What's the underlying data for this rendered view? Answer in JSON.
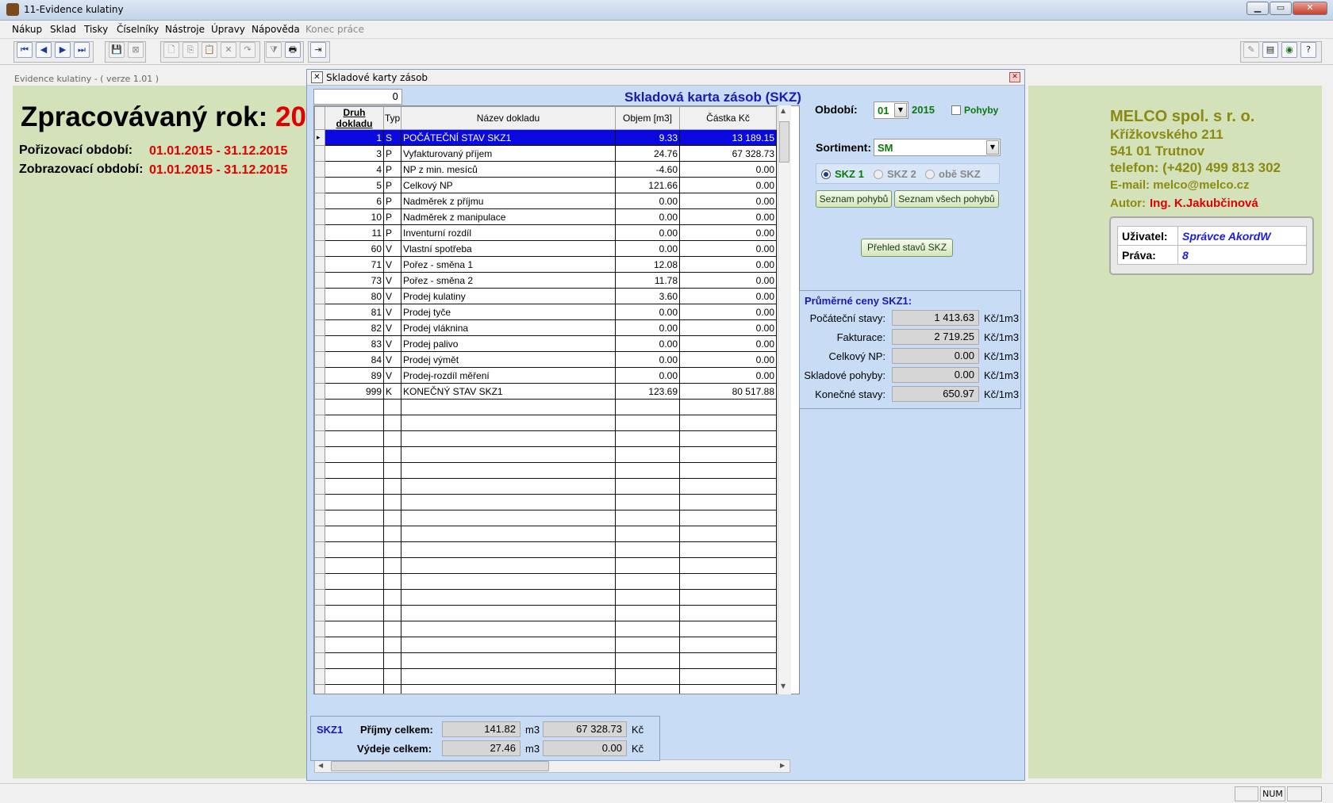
{
  "window": {
    "title": "11-Evidence kulatiny",
    "min_glyph": "▁",
    "max_glyph": "▭",
    "close_glyph": "✕"
  },
  "menu": {
    "items": [
      "Nákup",
      "Sklad",
      "Tisky",
      "Číselníky",
      "Nástroje",
      "Úpravy",
      "Nápověda"
    ],
    "disabled_item": "Konec práce"
  },
  "toolbar": {
    "nav_first": "⏮",
    "nav_prev": "◀",
    "nav_next": "▶",
    "nav_last": "⏭",
    "save": "💾",
    "cancel": "⊠",
    "new": "🗋",
    "copy": "⎘",
    "paste": "📋",
    "delete": "✕",
    "redo": "↷",
    "filter": "⧩",
    "print": "🖶",
    "exit": "⇥",
    "r1": "✎",
    "r2": "▤",
    "r3": "◉",
    "help": "?"
  },
  "left": {
    "version_line": "Evidence kulatiny   -   ( verze 1.01 )",
    "year_label": "Zpracovávaný rok:",
    "year_value": "20",
    "acq_label": "Pořizovací období:",
    "acq_value": "01.01.2015 - 31.12.2015",
    "disp_label": "Zobrazovací období:",
    "disp_value": "01.01.2015 - 31.12.2015"
  },
  "company": {
    "name": "MELCO spol. s r. o.",
    "street": "Křížkovského 211",
    "city": "541 01 Trutnov",
    "phone": "telefon: (+420) 499 813 302",
    "email": "E-mail: melco@melco.cz",
    "author_label": "Autor:",
    "author": "Ing. K.Jakubčinová"
  },
  "user": {
    "user_label": "Uživatel:",
    "user_value": "Správce AkordW",
    "rights_label": "Práva:",
    "rights_value": "8"
  },
  "dialog": {
    "title": "Skladové karty zásob",
    "heading": "Skladová karta zásob (SKZ)",
    "counter": "0",
    "close": "✕",
    "columns": [
      "Druh dokladu",
      "Typ",
      "Název dokladu",
      "Objem [m3]",
      "Částka Kč"
    ],
    "rows": [
      {
        "druh": "1",
        "typ": "S",
        "nazev": "POČÁTEČNÍ STAV SKZ1",
        "objem": "9.33",
        "castka": "13 189.15"
      },
      {
        "druh": "3",
        "typ": "P",
        "nazev": "Vyfakturovaný příjem",
        "objem": "24.76",
        "castka": "67 328.73"
      },
      {
        "druh": "4",
        "typ": "P",
        "nazev": "NP z min. mesíců",
        "objem": "-4.60",
        "castka": "0.00"
      },
      {
        "druh": "5",
        "typ": "P",
        "nazev": "Celkový NP",
        "objem": "121.66",
        "castka": "0.00"
      },
      {
        "druh": "6",
        "typ": "P",
        "nazev": "Nadměrek z příjmu",
        "objem": "0.00",
        "castka": "0.00"
      },
      {
        "druh": "10",
        "typ": "P",
        "nazev": "Nadměrek z manipulace",
        "objem": "0.00",
        "castka": "0.00"
      },
      {
        "druh": "11",
        "typ": "P",
        "nazev": "Inventurní rozdíl",
        "objem": "0.00",
        "castka": "0.00"
      },
      {
        "druh": "60",
        "typ": "V",
        "nazev": "Vlastní spotřeba",
        "objem": "0.00",
        "castka": "0.00"
      },
      {
        "druh": "71",
        "typ": "V",
        "nazev": "Pořez - směna 1",
        "objem": "12.08",
        "castka": "0.00"
      },
      {
        "druh": "73",
        "typ": "V",
        "nazev": "Pořez - směna 2",
        "objem": "11.78",
        "castka": "0.00"
      },
      {
        "druh": "80",
        "typ": "V",
        "nazev": "Prodej kulatiny",
        "objem": "3.60",
        "castka": "0.00"
      },
      {
        "druh": "81",
        "typ": "V",
        "nazev": "Prodej tyče",
        "objem": "0.00",
        "castka": "0.00"
      },
      {
        "druh": "82",
        "typ": "V",
        "nazev": "Prodej vláknina",
        "objem": "0.00",
        "castka": "0.00"
      },
      {
        "druh": "83",
        "typ": "V",
        "nazev": "Prodej palivo",
        "objem": "0.00",
        "castka": "0.00"
      },
      {
        "druh": "84",
        "typ": "V",
        "nazev": "Prodej výmět",
        "objem": "0.00",
        "castka": "0.00"
      },
      {
        "druh": "89",
        "typ": "V",
        "nazev": "Prodej-rozdíl měření",
        "objem": "0.00",
        "castka": "0.00"
      },
      {
        "druh": "999",
        "typ": "K",
        "nazev": "KONEČNÝ STAV SKZ1",
        "objem": "123.69",
        "castka": "80 517.88"
      }
    ],
    "empty_rows": 19,
    "period_label": "Období:",
    "period_value": "01",
    "period_year": "2015",
    "pohyby_label": "Pohyby",
    "sortiment_label": "Sortiment:",
    "sortiment_value": "SM",
    "radio": [
      "SKZ 1",
      "SKZ 2",
      "obě SKZ"
    ],
    "btn_seznam": "Seznam pohybů",
    "btn_seznam_vse": "Seznam všech pohybů",
    "btn_prehled": "Přehled stavů SKZ",
    "avg_title": "Průměrné ceny SKZ1:",
    "avg": [
      {
        "label": "Počáteční stavy:",
        "value": "1 413.63",
        "unit": "Kč/1m3"
      },
      {
        "label": "Fakturace:",
        "value": "2 719.25",
        "unit": "Kč/1m3"
      },
      {
        "label": "Celkový NP:",
        "value": "0.00",
        "unit": "Kč/1m3"
      },
      {
        "label": "Skladové pohyby:",
        "value": "0.00",
        "unit": "Kč/1m3"
      },
      {
        "label": "Konečné stavy:",
        "value": "650.97",
        "unit": "Kč/1m3"
      }
    ],
    "summary": {
      "skz": "SKZ1",
      "prijmy_label": "Příjmy celkem:",
      "prijmy_m3": "141.82",
      "prijmy_kc": "67 328.73",
      "vydeje_label": "Výdeje celkem:",
      "vydeje_m3": "27.46",
      "vydeje_kc": "0.00",
      "unit_m3": "m3",
      "unit_kc": "Kč"
    }
  },
  "status": {
    "num": "NUM"
  }
}
